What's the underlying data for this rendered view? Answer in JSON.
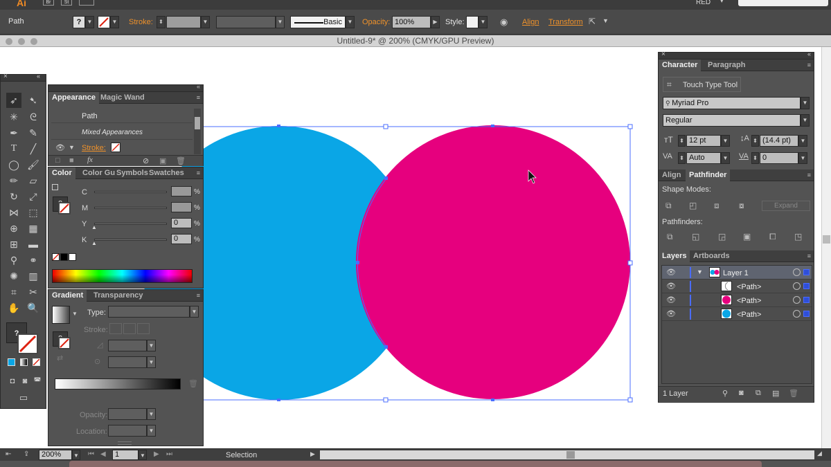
{
  "menubar": {
    "app_icon": "Ai",
    "box1": "Br",
    "box2": "St",
    "workspace": "RED"
  },
  "control_bar": {
    "selection_label": "Path",
    "stroke_label": "Stroke:",
    "brush_label": "Basic",
    "opacity_label": "Opacity:",
    "opacity_value": "100%",
    "style_label": "Style:",
    "align_label": "Align",
    "transform_label": "Transform"
  },
  "document": {
    "title": "Untitled-9* @ 200% (CMYK/GPU Preview)"
  },
  "appearance_panel": {
    "tabs": [
      "Appearance",
      "Magic Wand"
    ],
    "path_label": "Path",
    "mixed_label": "Mixed Appearances",
    "stroke_label": "Stroke:",
    "fx_label": "fx"
  },
  "color_panel": {
    "tabs": [
      "Color",
      "Color Gu",
      "Symbols",
      "Swatches"
    ],
    "channels": [
      {
        "label": "C",
        "value": "",
        "unit": "%"
      },
      {
        "label": "M",
        "value": "",
        "unit": "%"
      },
      {
        "label": "Y",
        "value": "0",
        "unit": "%"
      },
      {
        "label": "K",
        "value": "0",
        "unit": "%"
      }
    ]
  },
  "gradient_panel": {
    "tabs": [
      "Gradient",
      "Transparency"
    ],
    "type_label": "Type:",
    "stroke_label": "Stroke:",
    "opacity_label": "Opacity:",
    "location_label": "Location:"
  },
  "character_panel": {
    "tabs": [
      "Character",
      "Paragraph"
    ],
    "touch_type": "Touch Type Tool",
    "font_family": "Myriad Pro",
    "font_style": "Regular",
    "font_size": "12 pt",
    "leading": "(14.4 pt)",
    "kerning": "Auto",
    "tracking": "0"
  },
  "pathfinder_panel": {
    "tabs": [
      "Align",
      "Pathfinder"
    ],
    "shape_modes_label": "Shape Modes:",
    "pathfinders_label": "Pathfinders:",
    "expand_label": "Expand"
  },
  "layers_panel": {
    "tabs": [
      "Layers",
      "Artboards"
    ],
    "layers": [
      {
        "name": "Layer 1",
        "thumb": "#e0007a"
      },
      {
        "name": "<Path>",
        "thumb": "#ffffff"
      },
      {
        "name": "<Path>",
        "thumb": "#e6007e"
      },
      {
        "name": "<Path>",
        "thumb": "#0aa6e6"
      }
    ],
    "footer": "1 Layer"
  },
  "status_bar": {
    "zoom": "200%",
    "artboard": "1",
    "tool": "Selection"
  },
  "colors": {
    "cyan": "#0aa6e6",
    "magenta": "#e6007e",
    "selection": "#4a6cff"
  }
}
